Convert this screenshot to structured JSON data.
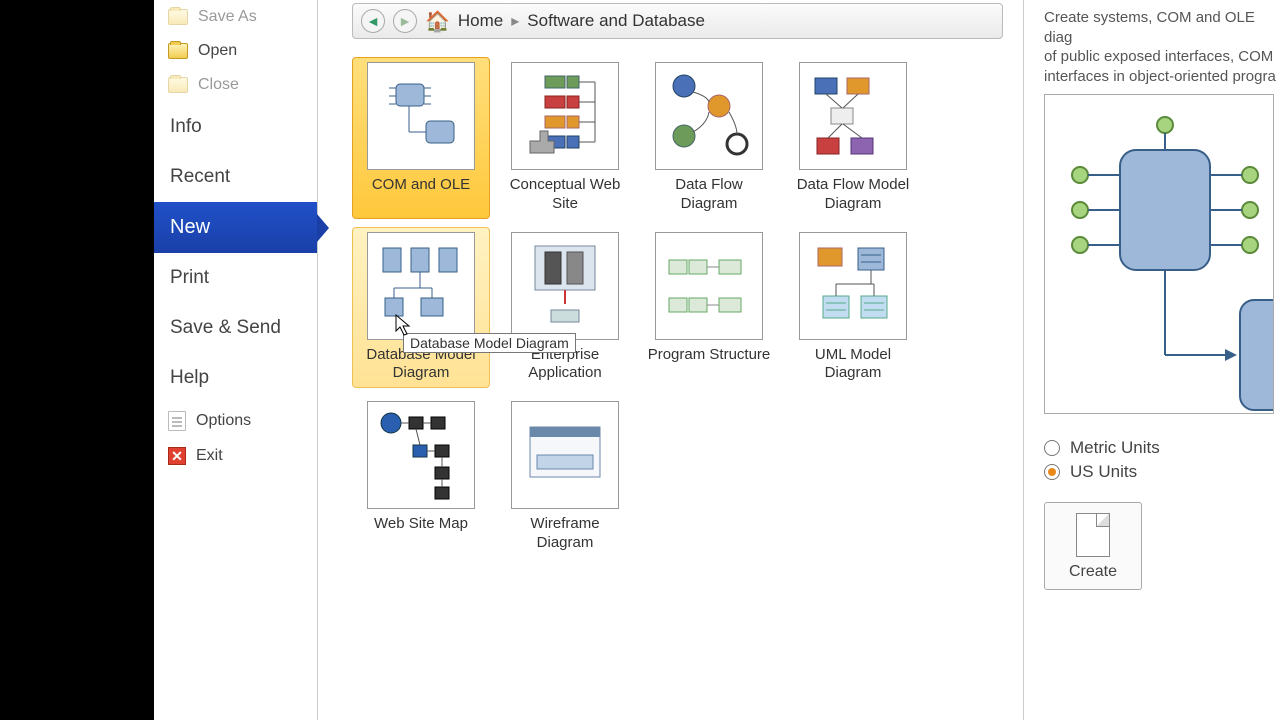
{
  "sidebar": {
    "saveAs": "Save As",
    "open": "Open",
    "close": "Close",
    "info": "Info",
    "recent": "Recent",
    "new": "New",
    "print": "Print",
    "saveSend": "Save & Send",
    "help": "Help",
    "options": "Options",
    "exit": "Exit"
  },
  "breadcrumb": {
    "home": "Home",
    "category": "Software and Database"
  },
  "templates": {
    "comOle": "COM and OLE",
    "conceptual": "Conceptual Web Site",
    "dataFlow": "Data Flow Diagram",
    "dataFlowModel": "Data Flow Model Diagram",
    "dbModel": "Database Model Diagram",
    "enterprise": "Enterprise Application",
    "program": "Program Structure",
    "uml": "UML Model Diagram",
    "webmap": "Web Site Map",
    "wireframe": "Wireframe Diagram"
  },
  "tooltip": "Database Model Diagram",
  "right": {
    "desc": "Create systems, COM and OLE diag\nof public exposed interfaces, COM\ninterfaces in object-oriented progra",
    "metric": "Metric Units",
    "us": "US Units",
    "create": "Create"
  }
}
